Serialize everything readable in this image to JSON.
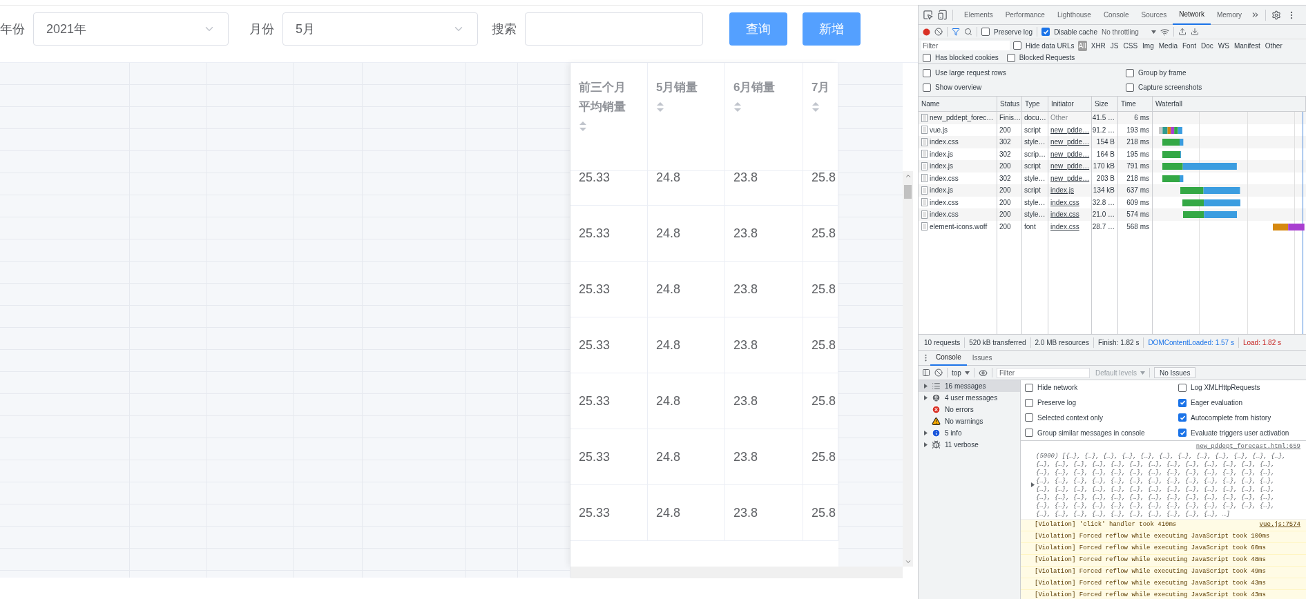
{
  "page": {
    "filters": [
      {
        "label": "年份",
        "value": "2021年"
      },
      {
        "label": "月份",
        "value": "5月"
      }
    ],
    "search": {
      "label": "搜索"
    },
    "buttons": [
      "查询",
      "新增"
    ],
    "table": {
      "columns": [
        "前三个月平均销量",
        "5月销量",
        "6月销量",
        "7月"
      ],
      "rows": [
        [
          "25.33",
          "24.8",
          "23.8",
          "25.8"
        ],
        [
          "25.33",
          "24.8",
          "23.8",
          "25.8"
        ],
        [
          "25.33",
          "24.8",
          "23.8",
          "25.8"
        ],
        [
          "25.33",
          "24.8",
          "23.8",
          "25.8"
        ],
        [
          "25.33",
          "24.8",
          "23.8",
          "25.8"
        ],
        [
          "25.33",
          "24.8",
          "23.8",
          "25.8"
        ],
        [
          "25.33",
          "24.8",
          "23.8",
          "25.8"
        ]
      ]
    }
  },
  "devtools": {
    "tabs": [
      {
        "label": "Elements",
        "selected": false
      },
      {
        "label": "Performance",
        "selected": false
      },
      {
        "label": "Lighthouse",
        "selected": false
      },
      {
        "label": "Console",
        "selected": false
      },
      {
        "label": "Sources",
        "selected": false
      },
      {
        "label": "Network",
        "selected": true
      },
      {
        "label": "Memory",
        "selected": false
      }
    ],
    "network": {
      "preserve_log": {
        "label": "Preserve log",
        "checked": false
      },
      "disable_cache": {
        "label": "Disable cache",
        "checked": true
      },
      "throttling": "No throttling",
      "filter_placeholder": "Filter",
      "hide_data_urls": {
        "label": "Hide data URLs",
        "checked": false
      },
      "types": [
        {
          "label": "All",
          "selected": true
        },
        {
          "label": "XHR",
          "selected": false
        },
        {
          "label": "JS",
          "selected": false
        },
        {
          "label": "CSS",
          "selected": false
        },
        {
          "label": "Img",
          "selected": false
        },
        {
          "label": "Media",
          "selected": false
        },
        {
          "label": "Font",
          "selected": false
        },
        {
          "label": "Doc",
          "selected": false
        },
        {
          "label": "WS",
          "selected": false
        },
        {
          "label": "Manifest",
          "selected": false
        },
        {
          "label": "Other",
          "selected": false
        }
      ],
      "blocked": [
        {
          "label": "Has blocked cookies",
          "checked": false
        },
        {
          "label": "Blocked Requests",
          "checked": false
        }
      ],
      "settings": [
        {
          "label": "Use large request rows",
          "checked": false
        },
        {
          "label": "Group by frame",
          "checked": false
        },
        {
          "label": "Show overview",
          "checked": false
        },
        {
          "label": "Capture screenshots",
          "checked": false
        }
      ],
      "columns": [
        "Name",
        "Status",
        "Type",
        "Initiator",
        "Size",
        "Time",
        "Waterfall"
      ],
      "requests": [
        {
          "name": "new_pddept_forec…",
          "status": "Finis…",
          "type": "docu…",
          "initiator": "Other",
          "initiator_link": false,
          "size": "41.5 …",
          "time": "6 ms"
        },
        {
          "name": "vue.js",
          "status": "200",
          "type": "script",
          "initiator": "new_pdde…",
          "initiator_link": true,
          "size": "91.2 …",
          "time": "193 ms"
        },
        {
          "name": "index.css",
          "status": "302",
          "type": "style…",
          "initiator": "new_pdde…",
          "initiator_link": true,
          "size": "154 B",
          "time": "218 ms"
        },
        {
          "name": "index.js",
          "status": "302",
          "type": "scrip…",
          "initiator": "new_pdde…",
          "initiator_link": true,
          "size": "164 B",
          "time": "195 ms"
        },
        {
          "name": "index.js",
          "status": "200",
          "type": "script",
          "initiator": "new_pdde…",
          "initiator_link": true,
          "size": "170 kB",
          "time": "791 ms"
        },
        {
          "name": "index.css",
          "status": "302",
          "type": "style…",
          "initiator": "new_pdde…",
          "initiator_link": true,
          "size": "203 B",
          "time": "218 ms"
        },
        {
          "name": "index.js",
          "status": "200",
          "type": "script",
          "initiator": "index.js",
          "initiator_link": true,
          "size": "134 kB",
          "time": "637 ms"
        },
        {
          "name": "index.css",
          "status": "200",
          "type": "style…",
          "initiator": "index.css",
          "initiator_link": true,
          "size": "32.8 …",
          "time": "609 ms"
        },
        {
          "name": "index.css",
          "status": "200",
          "type": "style…",
          "initiator": "index.css",
          "initiator_link": true,
          "size": "21.0 …",
          "time": "574 ms"
        },
        {
          "name": "element-icons.woff",
          "status": "200",
          "type": "font",
          "initiator": "index.css",
          "initiator_link": true,
          "size": "28.7 …",
          "time": "568 ms"
        }
      ],
      "summary": [
        {
          "kind": "stat",
          "text": "10 requests"
        },
        {
          "kind": "stat",
          "text": "520 kB transferred"
        },
        {
          "kind": "stat",
          "text": "2.0 MB resources"
        },
        {
          "kind": "stat",
          "text": "Finish: 1.82 s"
        },
        {
          "kind": "domcontentloaded",
          "text": "DOMContentLoaded: 1.57 s"
        },
        {
          "kind": "load",
          "text": "Load: 1.82 s"
        }
      ]
    },
    "drawer": {
      "tabs": [
        {
          "label": "Console",
          "selected": true
        },
        {
          "label": "Issues",
          "selected": false
        }
      ],
      "context": "top",
      "filter_placeholder": "Filter",
      "levels": "Default levels",
      "issues_button": "No Issues",
      "sidebar": [
        {
          "kind": "list",
          "label": "16 messages",
          "expandable": true,
          "selected": true
        },
        {
          "kind": "user",
          "label": "4 user messages",
          "expandable": true,
          "selected": false
        },
        {
          "kind": "error",
          "label": "No errors",
          "expandable": false,
          "selected": false
        },
        {
          "kind": "warning",
          "label": "No warnings",
          "expandable": false,
          "selected": false
        },
        {
          "kind": "info",
          "label": "5 info",
          "expandable": true,
          "selected": false
        },
        {
          "kind": "verbose",
          "label": "11 verbose",
          "expandable": true,
          "selected": false
        }
      ],
      "settings_left": [
        {
          "label": "Hide network",
          "checked": false
        },
        {
          "label": "Preserve log",
          "checked": false
        },
        {
          "label": "Selected context only",
          "checked": false
        },
        {
          "label": "Group similar messages in console",
          "checked": false
        }
      ],
      "settings_right": [
        {
          "label": "Log XMLHttpRequests",
          "checked": false
        },
        {
          "label": "Eager evaluation",
          "checked": true
        },
        {
          "label": "Autocomplete from history",
          "checked": true
        },
        {
          "label": "Evaluate triggers user activation",
          "checked": true
        }
      ],
      "messages": [
        {
          "kind": "log",
          "source": "new_pddept_forecast.html:659",
          "text": "(5000) [{…}, {…}, {…}, {…}, {…}, {…}, {…}, {…}, {…}, {…}, {…}, {…}, {…}, {…}, {…}, {…}, {…}, {…}, {…}, {…}, {…}, {…}, {…}, {…}, {…}, {…}, {…}, {…}, {…}, {…}, {…}, {…}, {…}, {…}, {…}, {…}, {…}, {…}, {…}, {…}, {…}, {…}, {…}, {…}, {…}, {…}, {…}, {…}, {…}, {…}, {…}, {…}, {…}, {…}, {…}, {…}, {…}, {…}, {…}, {…}, {…}, {…}, {…}, {…}, {…}, {…}, {…}, {…}, {…}, {…}, {…}, {…}, {…}, {…}, {…}, {…}, {…}, {…}, {…}, {…}, {…}, {…}, {…}, {…}, {…}, {…}, {…}, {…}, {…}, {…}, {…}, {…}, {…}, {…}, {…}, {…}, {…}, {…}, {…}, {…}, …]"
        },
        {
          "kind": "violation",
          "text": "[Violation] 'click' handler took 410ms",
          "source": "vue.js:7574"
        },
        {
          "kind": "violation",
          "text": "[Violation] Forced reflow while executing JavaScript took 100ms"
        },
        {
          "kind": "violation",
          "text": "[Violation] Forced reflow while executing JavaScript took 60ms"
        },
        {
          "kind": "violation",
          "text": "[Violation] Forced reflow while executing JavaScript took 48ms"
        },
        {
          "kind": "violation",
          "text": "[Violation] Forced reflow while executing JavaScript took 49ms"
        },
        {
          "kind": "violation",
          "text": "[Violation] Forced reflow while executing JavaScript took 43ms"
        },
        {
          "kind": "violation",
          "text": "[Violation] Forced reflow while executing JavaScript took 43ms"
        }
      ]
    }
  }
}
